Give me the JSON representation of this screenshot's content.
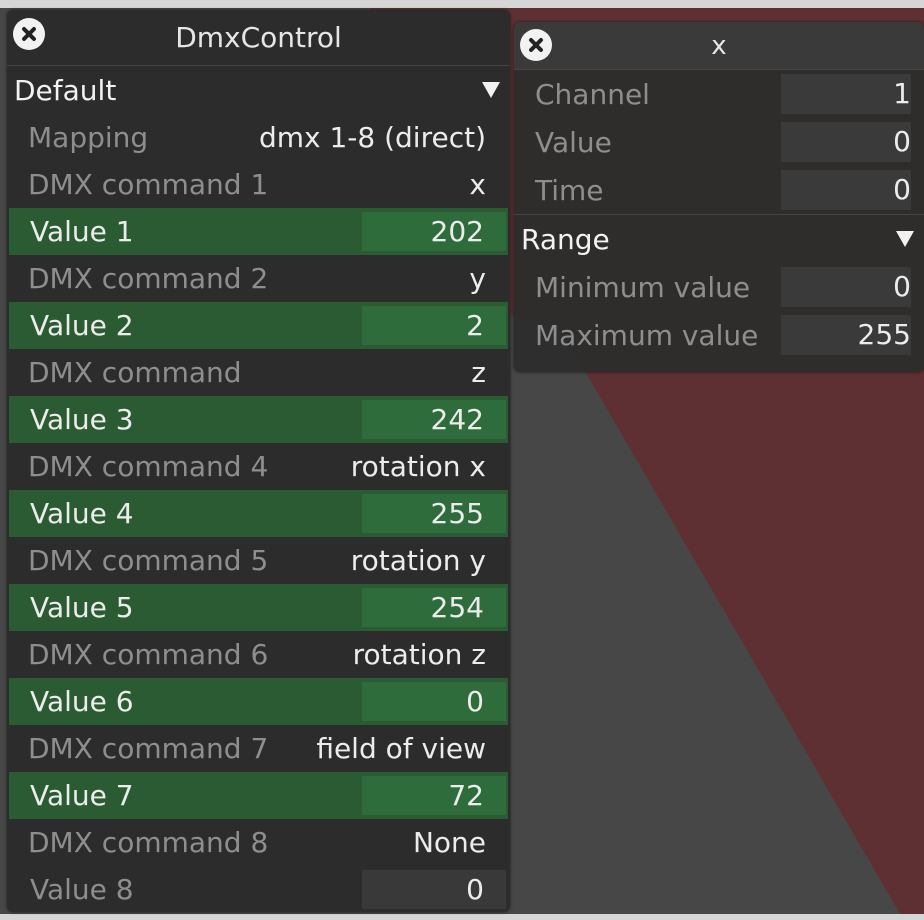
{
  "dmx_panel": {
    "title": "DmxControl",
    "section": "Default",
    "mapping": {
      "label": "Mapping",
      "value": "dmx 1-8 (direct)"
    },
    "rows": [
      {
        "kind": "command",
        "label": "DMX command 1",
        "value": "x"
      },
      {
        "kind": "value",
        "label": "Value 1",
        "value": "202"
      },
      {
        "kind": "command",
        "label": "DMX command 2",
        "value": "y"
      },
      {
        "kind": "value",
        "label": "Value 2",
        "value": "2"
      },
      {
        "kind": "command",
        "label": "DMX command",
        "value": "z"
      },
      {
        "kind": "value",
        "label": "Value 3",
        "value": "242"
      },
      {
        "kind": "command",
        "label": "DMX command 4",
        "value": "rotation x"
      },
      {
        "kind": "value",
        "label": "Value 4",
        "value": "255"
      },
      {
        "kind": "command",
        "label": "DMX command 5",
        "value": "rotation y"
      },
      {
        "kind": "value",
        "label": "Value 5",
        "value": "254"
      },
      {
        "kind": "command",
        "label": "DMX command 6",
        "value": "rotation z"
      },
      {
        "kind": "value",
        "label": "Value 6",
        "value": "0"
      },
      {
        "kind": "command",
        "label": "DMX command 7",
        "value": "field of view"
      },
      {
        "kind": "value",
        "label": "Value 7",
        "value": "72"
      },
      {
        "kind": "command",
        "label": "DMX command 8",
        "value": "None"
      },
      {
        "kind": "value",
        "label": "Value 8",
        "value": "0"
      }
    ]
  },
  "x_panel": {
    "title": "x",
    "channel": {
      "label": "Channel",
      "value": "1"
    },
    "value": {
      "label": "Value",
      "value": "0"
    },
    "time": {
      "label": "Time",
      "value": "0"
    },
    "range_section": "Range",
    "min": {
      "label": "Minimum value",
      "value": "0"
    },
    "max": {
      "label": "Maximum value",
      "value": "255"
    }
  },
  "colors": {
    "scene_red": "#5e3034",
    "scene_gray": "#474747",
    "slider_green": "#2b5b33"
  }
}
